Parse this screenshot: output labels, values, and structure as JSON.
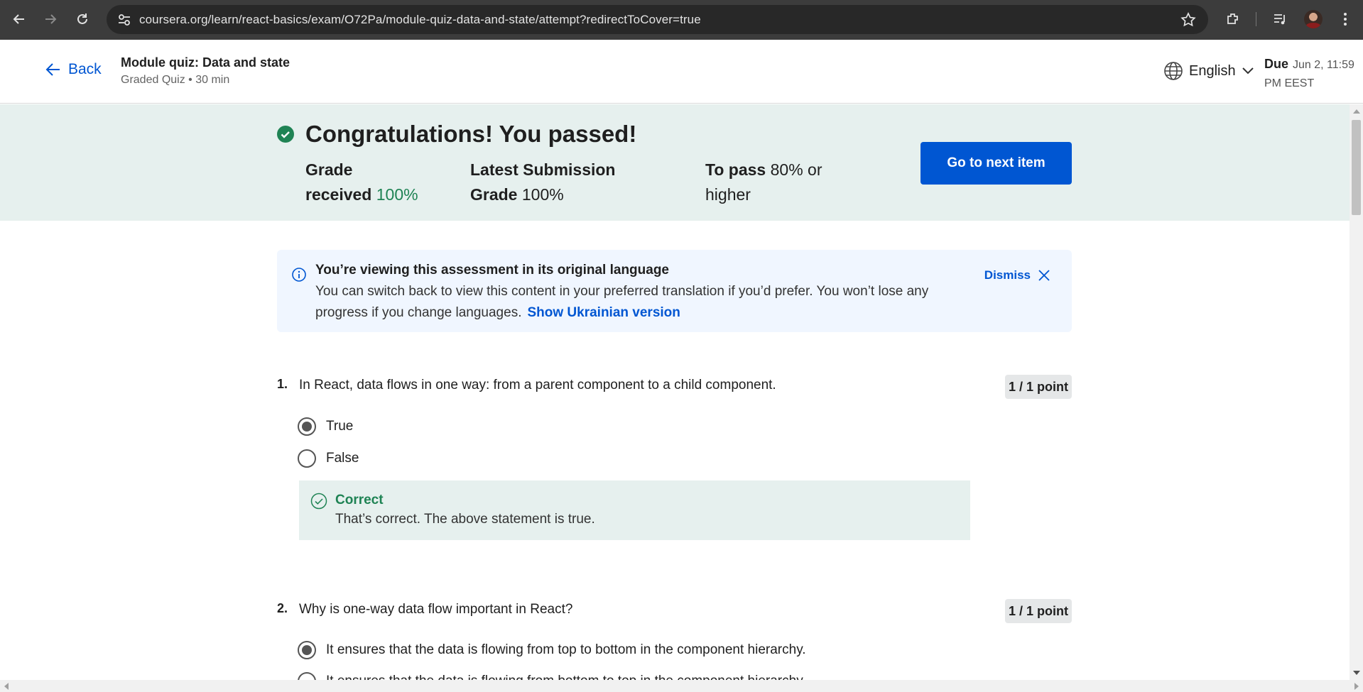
{
  "browser": {
    "url": "coursera.org/learn/react-basics/exam/O72Pa/module-quiz-data-and-state/attempt?redirectToCover=true"
  },
  "header": {
    "back_label": "Back",
    "title": "Module quiz: Data and state",
    "subtitle": "Graded Quiz • 30 min",
    "language": "English",
    "due_label": "Due",
    "due_value_line1": "Jun 2, 11:59",
    "due_value_line2": "PM EEST"
  },
  "result": {
    "headline": "Congratulations! You passed!",
    "grade_label_1": "Grade",
    "grade_label_2": "received",
    "grade_value": "100%",
    "latest_label_1": "Latest Submission",
    "latest_label_2": "Grade",
    "latest_value": "100%",
    "pass_label": "To pass",
    "pass_value_1": "80% or",
    "pass_value_2": "higher",
    "next_button": "Go to next item",
    "accent_color": "#1f8354"
  },
  "notice": {
    "title": "You’re viewing this assessment in its original language",
    "line1": "You can switch back to view this content in your preferred translation if you’d prefer. You won’t lose any",
    "line2": "progress if you change languages.",
    "link": "Show Ukrainian version",
    "dismiss": "Dismiss"
  },
  "questions": [
    {
      "number": "1.",
      "text": "In React, data flows in one way: from a parent component to a child component.",
      "points": "1 / 1 point",
      "options": [
        {
          "label": "True",
          "selected": true
        },
        {
          "label": "False",
          "selected": false
        }
      ],
      "feedback_title": "Correct",
      "feedback_text": "That’s correct. The above statement is true."
    },
    {
      "number": "2.",
      "text": "Why is one-way data flow important in React?",
      "points": "1 / 1 point",
      "options": [
        {
          "label": "It ensures that the data is flowing from top to bottom in the component hierarchy.",
          "selected": true
        },
        {
          "label": "It ensures that the data is flowing from bottom to top in the component hierarchy.",
          "selected": false
        }
      ]
    }
  ],
  "colors": {
    "brand_blue": "#0056d2",
    "success_green": "#1f8354",
    "banner_bg": "#e6f0ee"
  }
}
